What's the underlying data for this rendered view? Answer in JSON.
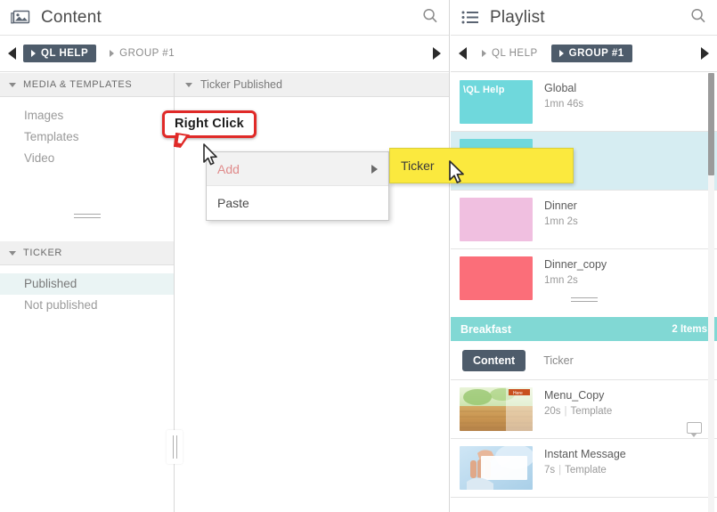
{
  "content_pane": {
    "title": "Content",
    "icon": "image-icon",
    "search_icon": "search-icon",
    "breadcrumb": {
      "left_arrow": "prev-arrow-icon",
      "right_arrow": "next-arrow-icon",
      "items": [
        {
          "label": "QL HELP",
          "active": true
        },
        {
          "label": "GROUP #1",
          "active": false
        }
      ]
    },
    "sidebar": {
      "sections": [
        {
          "title": "MEDIA & TEMPLATES",
          "items": [
            {
              "label": "Images",
              "selected": false
            },
            {
              "label": "Templates",
              "selected": false
            },
            {
              "label": "Video",
              "selected": false
            }
          ]
        },
        {
          "title": "TICKER",
          "items": [
            {
              "label": "Published",
              "selected": true
            },
            {
              "label": "Not published",
              "selected": false
            }
          ]
        }
      ]
    },
    "main": {
      "header": "Ticker Published"
    },
    "context_menu": {
      "items": [
        {
          "label": "Add",
          "highlighted": true,
          "has_submenu": true
        },
        {
          "label": "Paste",
          "highlighted": false,
          "has_submenu": false
        }
      ],
      "submenu": [
        {
          "label": "Ticker"
        }
      ]
    },
    "callout": {
      "text": "Right Click",
      "border_color": "#e02a28"
    }
  },
  "playlist_pane": {
    "title": "Playlist",
    "icon": "list-icon",
    "search_icon": "search-icon",
    "breadcrumb": {
      "left_arrow": "prev-arrow-icon",
      "right_arrow": "next-arrow-icon",
      "items": [
        {
          "label": "QL HELP",
          "active": false
        },
        {
          "label": "GROUP #1",
          "active": true
        }
      ]
    },
    "items": [
      {
        "name": "Global",
        "duration": "1mn 46s",
        "thumb_color": "#6fd8dc",
        "thumb_label": "\\QL Help",
        "selected": false
      },
      {
        "name": "",
        "duration": "",
        "thumb_color": "#6fd8dc",
        "thumb_label": "",
        "selected": true
      },
      {
        "name": "Dinner",
        "duration": "1mn 2s",
        "thumb_color": "#f0bfe0",
        "thumb_label": "",
        "selected": false
      },
      {
        "name": "Dinner_copy",
        "duration": "1mn 2s",
        "thumb_color": "#fb6e79",
        "thumb_label": "",
        "selected": false
      }
    ],
    "group": {
      "name": "Breakfast",
      "count": "2 Items",
      "color": "#81d8d4",
      "tabs": [
        {
          "label": "Content",
          "active": true
        },
        {
          "label": "Ticker",
          "active": false
        }
      ],
      "items": [
        {
          "name": "Menu_Copy",
          "duration": "20s",
          "kind": "Template",
          "thumb": "menu-thumb"
        },
        {
          "name": "Instant Message",
          "duration": "7s",
          "kind": "Template",
          "thumb": "hand-card-thumb"
        }
      ]
    }
  }
}
